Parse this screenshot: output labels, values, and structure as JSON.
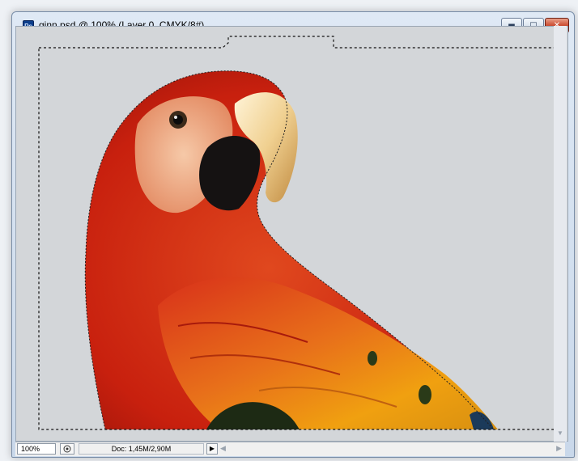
{
  "window": {
    "app_badge": "Ps",
    "title": "ginn.psd @ 100% (Layer 0, CMYK/8#)"
  },
  "status_bar": {
    "zoom_value": "100%",
    "doc_info": "Doc: 1,45M/2,90M"
  },
  "icons": {
    "app": "photoshop-document-icon",
    "minimize": "minimize-icon",
    "maximize": "maximize-icon",
    "close": "close-icon",
    "status": "status-bar-info-icon",
    "menu": "status-menu-arrow-icon",
    "scroll_left": "scroll-left-icon",
    "scroll_right": "scroll-right-icon",
    "scroll_down": "scroll-down-icon"
  },
  "colors": {
    "canvas_background": "#d3d6d9",
    "close_button": "#c8452a",
    "parrot_red": "#c8200e",
    "parrot_yellow": "#f0a010"
  }
}
